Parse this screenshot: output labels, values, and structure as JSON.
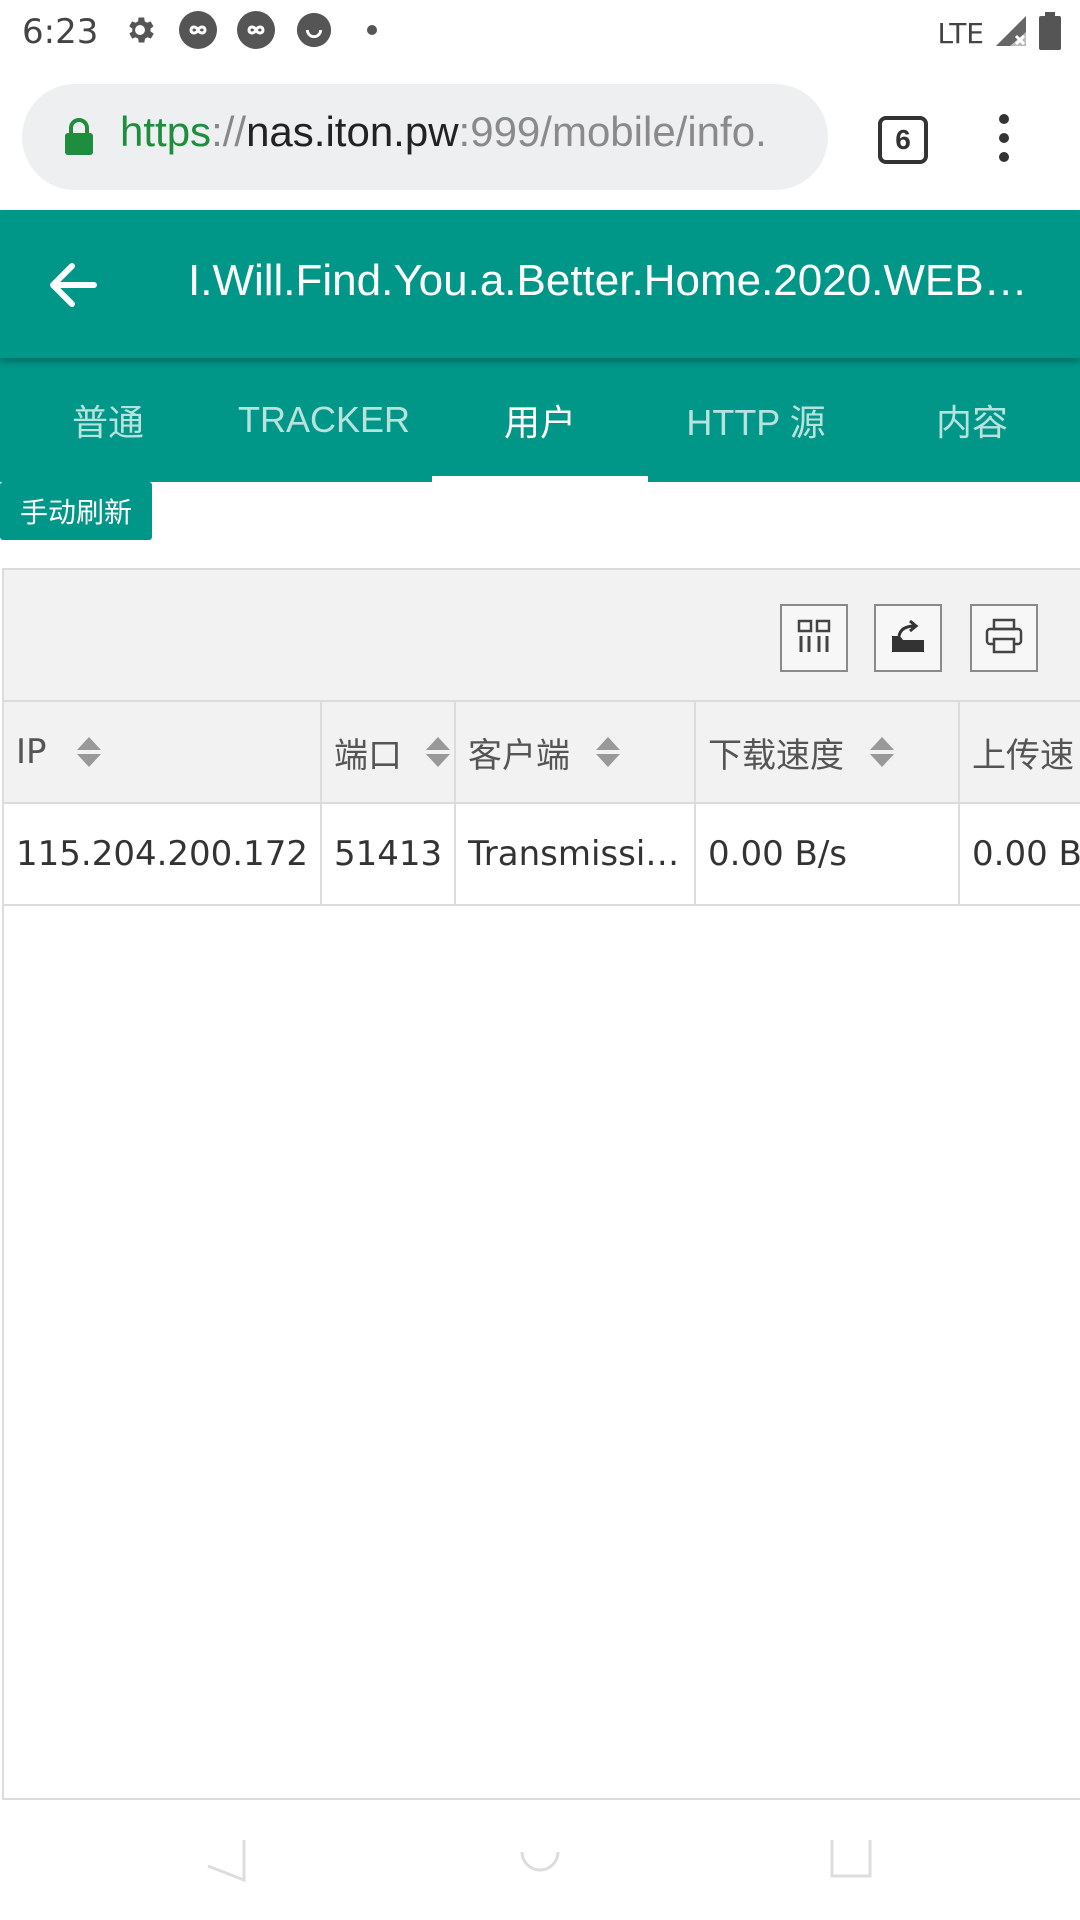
{
  "status_bar": {
    "time": "6:23",
    "left_icons": [
      "gear-icon",
      "infinity-icon",
      "infinity-icon",
      "smiley-icon",
      "dot-icon"
    ],
    "network": "LTE"
  },
  "browser": {
    "url_scheme": "https",
    "url_separator": "://",
    "url_host": "nas.iton.pw",
    "url_path": ":999/mobile/info.",
    "tab_count": "6"
  },
  "app_header": {
    "title": "I.Will.Find.You.a.Better.Home.2020.WEB…"
  },
  "tabs": [
    {
      "label": "普通",
      "active": false
    },
    {
      "label": "TRACKER",
      "active": false
    },
    {
      "label": "用户",
      "active": true
    },
    {
      "label": "HTTP 源",
      "active": false
    },
    {
      "label": "内容",
      "active": false
    }
  ],
  "refresh_button": "手动刷新",
  "toolbar": {
    "icons": [
      "columns-icon",
      "export-icon",
      "print-icon"
    ]
  },
  "table": {
    "headers": [
      "IP",
      "端口",
      "客户端",
      "下载速度",
      "上传速"
    ],
    "rows": [
      [
        "115.204.200.172",
        "51413",
        "Transmissi…",
        "0.00 B/s",
        "0.00 B/"
      ]
    ]
  },
  "colors": {
    "accent": "#009688",
    "url_scheme": "#1e8e3e"
  }
}
